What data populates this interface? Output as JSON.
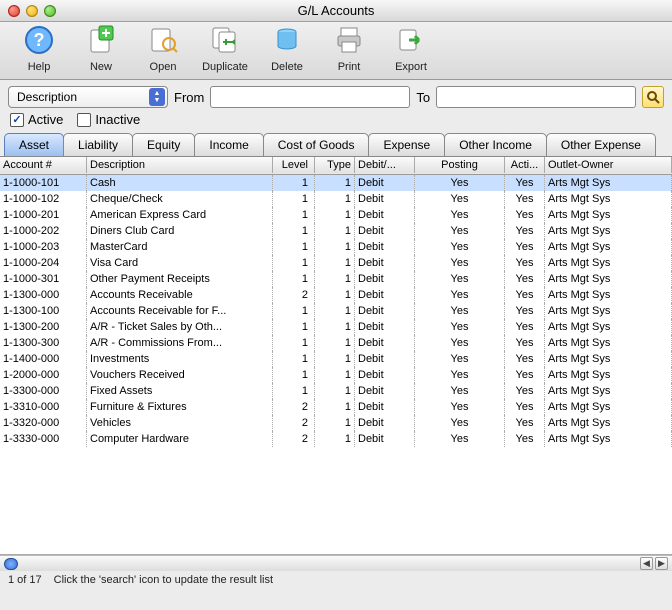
{
  "window": {
    "title": "G/L Accounts"
  },
  "toolbar": {
    "help": "Help",
    "new": "New",
    "open": "Open",
    "duplicate": "Duplicate",
    "delete": "Delete",
    "print": "Print",
    "export": "Export"
  },
  "filter": {
    "field": "Description",
    "from_label": "From",
    "from_value": "",
    "to_label": "To",
    "to_value": ""
  },
  "checks": {
    "active_label": "Active",
    "active_checked": true,
    "inactive_label": "Inactive",
    "inactive_checked": false
  },
  "tabs": {
    "items": [
      "Asset",
      "Liability",
      "Equity",
      "Income",
      "Cost of Goods",
      "Expense",
      "Other Income",
      "Other Expense"
    ],
    "active": 0
  },
  "columns": [
    "Account #",
    "Description",
    "Level",
    "Type",
    "Debit/...",
    "Posting",
    "Acti...",
    "Outlet-Owner"
  ],
  "rows": [
    {
      "acct": "1-1000-101",
      "desc": "Cash",
      "level": "1",
      "type": "1",
      "dc": "Debit",
      "posting": "Yes",
      "active": "Yes",
      "owner": "Arts Mgt Sys",
      "sel": true
    },
    {
      "acct": "1-1000-102",
      "desc": "Cheque/Check",
      "level": "1",
      "type": "1",
      "dc": "Debit",
      "posting": "Yes",
      "active": "Yes",
      "owner": "Arts Mgt Sys"
    },
    {
      "acct": "1-1000-201",
      "desc": "American Express Card",
      "level": "1",
      "type": "1",
      "dc": "Debit",
      "posting": "Yes",
      "active": "Yes",
      "owner": "Arts Mgt Sys"
    },
    {
      "acct": "1-1000-202",
      "desc": "Diners Club Card",
      "level": "1",
      "type": "1",
      "dc": "Debit",
      "posting": "Yes",
      "active": "Yes",
      "owner": "Arts Mgt Sys"
    },
    {
      "acct": "1-1000-203",
      "desc": "MasterCard",
      "level": "1",
      "type": "1",
      "dc": "Debit",
      "posting": "Yes",
      "active": "Yes",
      "owner": "Arts Mgt Sys"
    },
    {
      "acct": "1-1000-204",
      "desc": "Visa Card",
      "level": "1",
      "type": "1",
      "dc": "Debit",
      "posting": "Yes",
      "active": "Yes",
      "owner": "Arts Mgt Sys"
    },
    {
      "acct": "1-1000-301",
      "desc": "Other Payment Receipts",
      "level": "1",
      "type": "1",
      "dc": "Debit",
      "posting": "Yes",
      "active": "Yes",
      "owner": "Arts Mgt Sys"
    },
    {
      "acct": "1-1300-000",
      "desc": "Accounts Receivable",
      "level": "2",
      "type": "1",
      "dc": "Debit",
      "posting": "Yes",
      "active": "Yes",
      "owner": "Arts Mgt Sys"
    },
    {
      "acct": "1-1300-100",
      "desc": "Accounts Receivable for F...",
      "level": "1",
      "type": "1",
      "dc": "Debit",
      "posting": "Yes",
      "active": "Yes",
      "owner": "Arts Mgt Sys"
    },
    {
      "acct": "1-1300-200",
      "desc": "A/R - Ticket Sales by Oth...",
      "level": "1",
      "type": "1",
      "dc": "Debit",
      "posting": "Yes",
      "active": "Yes",
      "owner": "Arts Mgt Sys"
    },
    {
      "acct": "1-1300-300",
      "desc": "A/R - Commissions From...",
      "level": "1",
      "type": "1",
      "dc": "Debit",
      "posting": "Yes",
      "active": "Yes",
      "owner": "Arts Mgt Sys"
    },
    {
      "acct": "1-1400-000",
      "desc": "Investments",
      "level": "1",
      "type": "1",
      "dc": "Debit",
      "posting": "Yes",
      "active": "Yes",
      "owner": "Arts Mgt Sys"
    },
    {
      "acct": "1-2000-000",
      "desc": "Vouchers Received",
      "level": "1",
      "type": "1",
      "dc": "Debit",
      "posting": "Yes",
      "active": "Yes",
      "owner": "Arts Mgt Sys"
    },
    {
      "acct": "1-3300-000",
      "desc": "Fixed Assets",
      "level": "1",
      "type": "1",
      "dc": "Debit",
      "posting": "Yes",
      "active": "Yes",
      "owner": "Arts Mgt Sys"
    },
    {
      "acct": "1-3310-000",
      "desc": "Furniture & Fixtures",
      "level": "2",
      "type": "1",
      "dc": "Debit",
      "posting": "Yes",
      "active": "Yes",
      "owner": "Arts Mgt Sys"
    },
    {
      "acct": "1-3320-000",
      "desc": "Vehicles",
      "level": "2",
      "type": "1",
      "dc": "Debit",
      "posting": "Yes",
      "active": "Yes",
      "owner": "Arts Mgt Sys"
    },
    {
      "acct": "1-3330-000",
      "desc": "Computer Hardware",
      "level": "2",
      "type": "1",
      "dc": "Debit",
      "posting": "Yes",
      "active": "Yes",
      "owner": "Arts Mgt Sys"
    }
  ],
  "status": {
    "count": "1 of 17",
    "hint": "Click the 'search' icon to update the result list"
  }
}
